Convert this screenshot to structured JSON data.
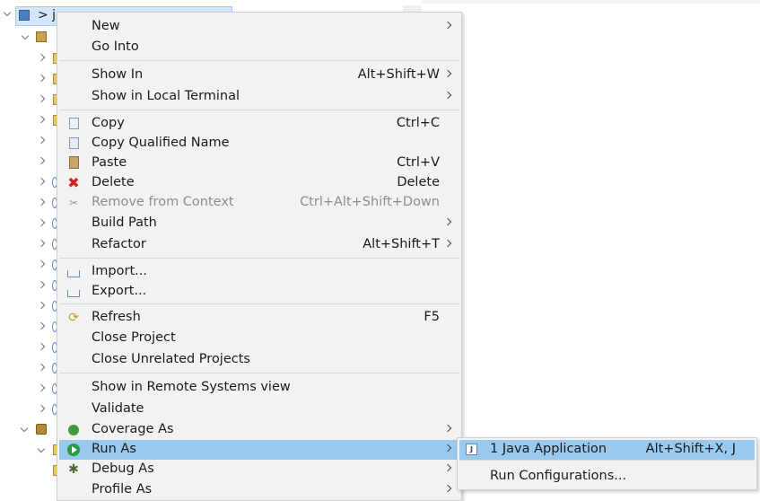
{
  "explorer": {
    "selected_item_text": "> ja"
  },
  "context_menu": {
    "items": [
      {
        "label": "New",
        "accelerator": "",
        "submenu": true
      },
      {
        "label": "Go Into",
        "accelerator": "",
        "submenu": false
      },
      {
        "label": "Show In",
        "accelerator": "Alt+Shift+W",
        "submenu": true
      },
      {
        "label": "Show in Local Terminal",
        "accelerator": "",
        "submenu": true
      },
      {
        "label": "Copy",
        "accelerator": "Ctrl+C",
        "submenu": false
      },
      {
        "label": "Copy Qualified Name",
        "accelerator": "",
        "submenu": false
      },
      {
        "label": "Paste",
        "accelerator": "Ctrl+V",
        "submenu": false
      },
      {
        "label": "Delete",
        "accelerator": "Delete",
        "submenu": false
      },
      {
        "label": "Remove from Context",
        "accelerator": "Ctrl+Alt+Shift+Down",
        "submenu": false,
        "disabled": true
      },
      {
        "label": "Build Path",
        "accelerator": "",
        "submenu": true
      },
      {
        "label": "Refactor",
        "accelerator": "Alt+Shift+T",
        "submenu": true
      },
      {
        "label": "Import...",
        "accelerator": "",
        "submenu": false
      },
      {
        "label": "Export...",
        "accelerator": "",
        "submenu": false
      },
      {
        "label": "Refresh",
        "accelerator": "F5",
        "submenu": false
      },
      {
        "label": "Close Project",
        "accelerator": "",
        "submenu": false
      },
      {
        "label": "Close Unrelated Projects",
        "accelerator": "",
        "submenu": false
      },
      {
        "label": "Show in Remote Systems view",
        "accelerator": "",
        "submenu": false
      },
      {
        "label": "Validate",
        "accelerator": "",
        "submenu": false
      },
      {
        "label": "Coverage As",
        "accelerator": "",
        "submenu": true
      },
      {
        "label": "Run As",
        "accelerator": "",
        "submenu": true,
        "highlighted": true
      },
      {
        "label": "Debug As",
        "accelerator": "",
        "submenu": true
      },
      {
        "label": "Profile As",
        "accelerator": "",
        "submenu": true
      }
    ]
  },
  "run_as_submenu": {
    "items": [
      {
        "label": "1 Java Application",
        "accelerator": "Alt+Shift+X, J",
        "icon": "java-app-icon"
      },
      {
        "label": "Run Configurations...",
        "accelerator": ""
      }
    ]
  }
}
